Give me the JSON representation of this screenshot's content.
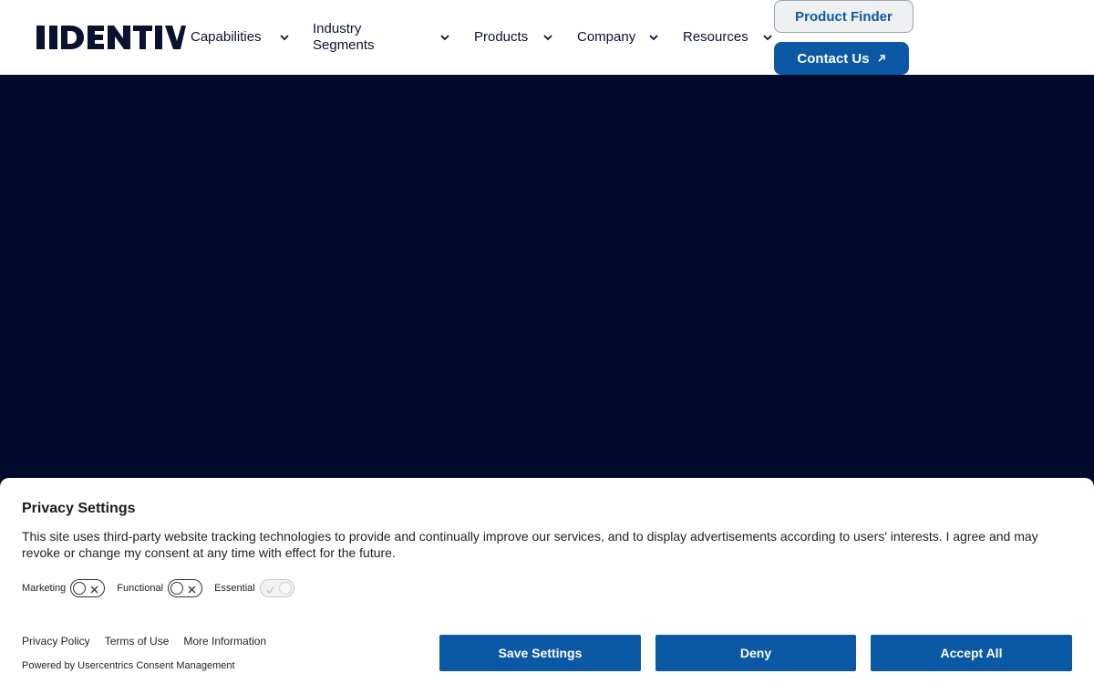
{
  "header": {
    "logo_text": "IDENTIV",
    "nav": [
      {
        "label": "Capabilities"
      },
      {
        "label": "Industry Segments"
      },
      {
        "label": "Products"
      },
      {
        "label": "Company"
      },
      {
        "label": "Resources"
      }
    ],
    "product_finder_label": "Product Finder",
    "contact_label": "Contact Us"
  },
  "consent": {
    "title": "Privacy Settings",
    "description": "This site uses third-party website tracking technologies to provide and continually improve our services, and to display advertisements according to users' interests. I agree and may revoke or change my consent at any time with effect for the future.",
    "toggles": [
      {
        "label": "Marketing",
        "state": "off"
      },
      {
        "label": "Functional",
        "state": "off"
      },
      {
        "label": "Essential",
        "state": "on-disabled"
      }
    ],
    "links": [
      "Privacy Policy",
      "Terms of Use",
      "More Information"
    ],
    "powered_by": "Powered by Usercentrics Consent Management",
    "buttons": {
      "save": "Save Settings",
      "deny": "Deny",
      "accept": "Accept All"
    }
  },
  "colors": {
    "brand_navy": "#0a1230",
    "hero_bg": "#000a2b",
    "accent_blue": "#0b58a4"
  },
  "icons": {
    "nav_dropdown": "chevron-down-icon",
    "contact": "arrow-up-right-icon",
    "toggle_off": "x-icon",
    "toggle_on": "check-icon"
  }
}
